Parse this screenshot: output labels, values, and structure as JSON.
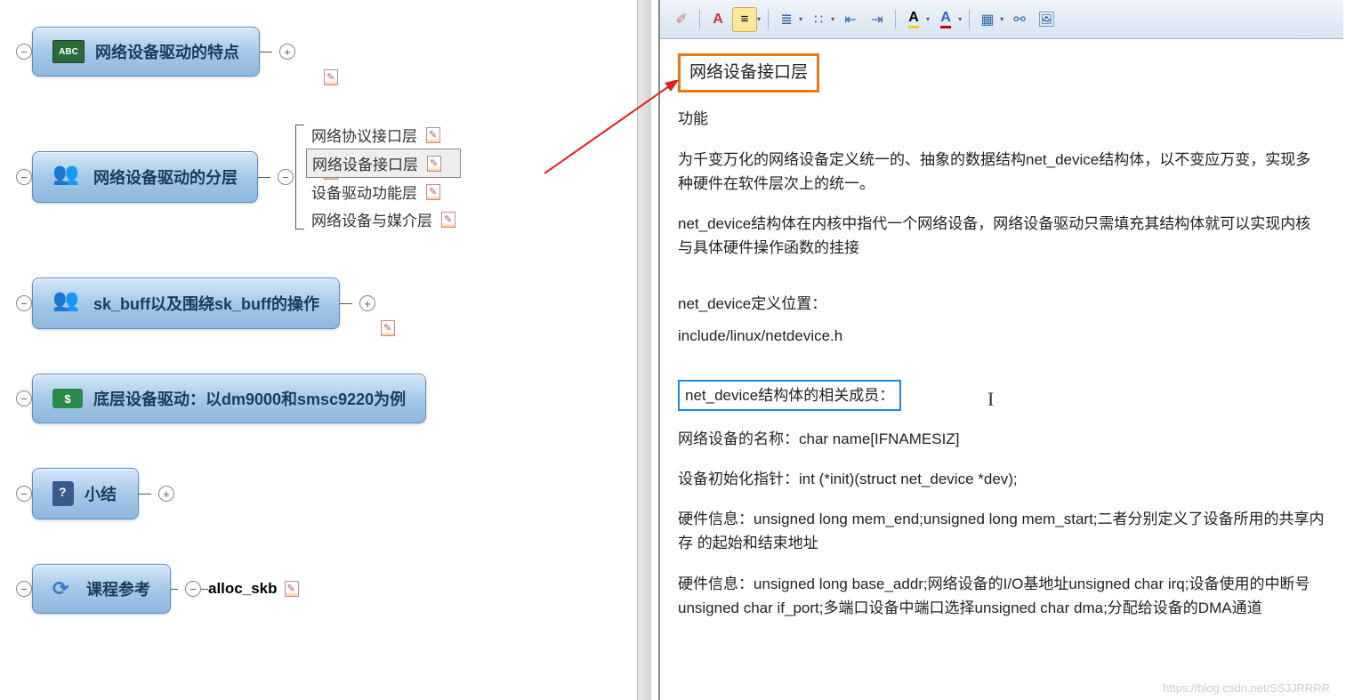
{
  "mindmap": {
    "nodes": [
      {
        "label": "网络设备驱动的特点",
        "icon": "abc"
      },
      {
        "label": "网络设备驱动的分层",
        "icon": "people",
        "children": [
          {
            "label": "网络协议接口层",
            "selected": false
          },
          {
            "label": "网络设备接口层",
            "selected": true
          },
          {
            "label": "设备驱动功能层",
            "selected": false
          },
          {
            "label": "网络设备与媒介层",
            "selected": false
          }
        ]
      },
      {
        "label": "sk_buff以及围绕sk_buff的操作",
        "icon": "people"
      },
      {
        "label": "底层设备驱动：以dm9000和smsc9220为例",
        "icon": "money"
      },
      {
        "label": "小结",
        "icon": "book"
      },
      {
        "label": "课程参考",
        "icon": "refresh",
        "child_single": "alloc_skb"
      }
    ]
  },
  "toolbar": {
    "format_painter": "格式刷",
    "font_btn": "A",
    "align": "≡",
    "list_num_glyph": "≣",
    "list_bul_glyph": "⁝≡",
    "indent_dec": "≤",
    "indent_inc": "≥",
    "highlight_glyph": "A",
    "font_color_glyph": "A",
    "table_glyph": "▦",
    "link_glyph": "⚯",
    "image_glyph": "▭"
  },
  "doc": {
    "title": "网络设备接口层",
    "p1": "功能",
    "p2": "为千变万化的网络设备定义统一的、抽象的数据结构net_device结构体，以不变应万变，实现多种硬件在软件层次上的统一。",
    "p3": "net_device结构体在内核中指代一个网络设备，网络设备驱动只需填充其结构体就可以实现内核与具体硬件操作函数的挂接",
    "p4": "net_device定义位置：",
    "p5": "include/linux/netdevice.h",
    "highlight": "net_device结构体的相关成员：",
    "p6": "网络设备的名称：char name[IFNAMESIZ]",
    "p7": "设备初始化指针：int (*init)(struct net_device *dev);",
    "p8": "硬件信息：unsigned long mem_end;unsigned long mem_start;二者分别定义了设备所用的共享内存 的起始和结束地址",
    "p9": "硬件信息：unsigned long base_addr;网络设备的I/O基地址unsigned char irq;设备使用的中断号unsigned char if_port;多端口设备中端口选择unsigned char dma;分配给设备的DMA通道"
  },
  "watermark": "https://blog.csdn.net/SSJJRRRR"
}
